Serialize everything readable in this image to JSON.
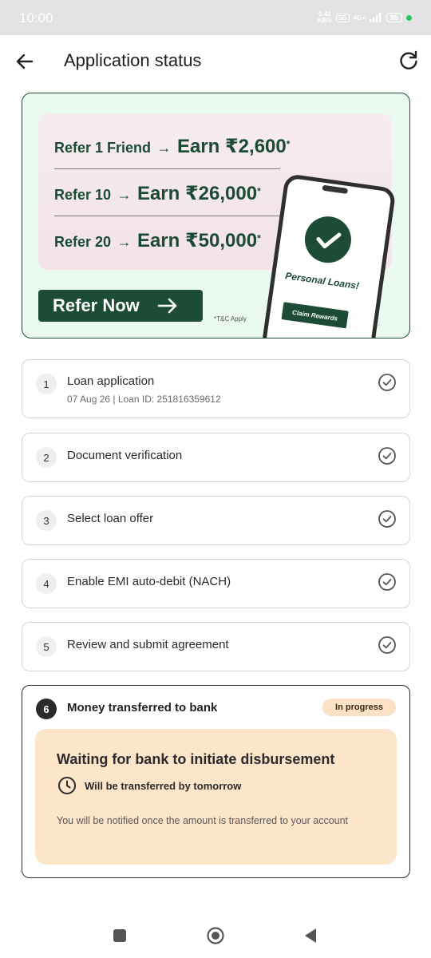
{
  "status_bar": {
    "time": "10:00",
    "speed_value": "0.42",
    "speed_unit": "KB/s",
    "network_badge": "5G",
    "signal_label": "4G+",
    "battery": "95"
  },
  "header": {
    "title": "Application status",
    "back_icon": "arrow-left-icon",
    "refresh_icon": "refresh-icon"
  },
  "banner": {
    "lines": [
      {
        "prefix": "Refer 1 Friend",
        "arrow": "→",
        "reward": "Earn ₹2,600",
        "mark": "*"
      },
      {
        "prefix": "Refer 10",
        "arrow": "→",
        "reward": "Earn ₹26,000",
        "mark": "*"
      },
      {
        "prefix": "Refer 20",
        "arrow": "→",
        "reward": "Earn ₹50,000",
        "mark": "*"
      }
    ],
    "cta_label": "Refer Now",
    "cta_arrow": "→",
    "tnc": "*T&C Apply",
    "phone_text": "Personal Loans!",
    "phone_button": "Claim Rewards",
    "colors": {
      "brand_green": "#1c4b36",
      "banner_bg": "#eafaef"
    }
  },
  "steps": [
    {
      "number": "1",
      "label": "Loan application",
      "sub": "07 Aug 26 | Loan ID: 251816359612",
      "status": "completed"
    },
    {
      "number": "2",
      "label": "Document verification",
      "status": "completed"
    },
    {
      "number": "3",
      "label": "Select loan offer",
      "status": "completed"
    },
    {
      "number": "4",
      "label": "Enable EMI auto-debit (NACH)",
      "status": "completed"
    },
    {
      "number": "5",
      "label": "Review and submit agreement",
      "status": "completed"
    }
  ],
  "active_step": {
    "number": "6",
    "label": "Money transferred to bank",
    "badge": "In progress",
    "card_title": "Waiting for bank to initiate disbursement",
    "eta": "Will be transferred by tomorrow",
    "note": "You will be notified once the amount is transferred to your account",
    "colors": {
      "badge_bg": "#fbe2c6",
      "card_bg": "#fde5ca"
    }
  }
}
